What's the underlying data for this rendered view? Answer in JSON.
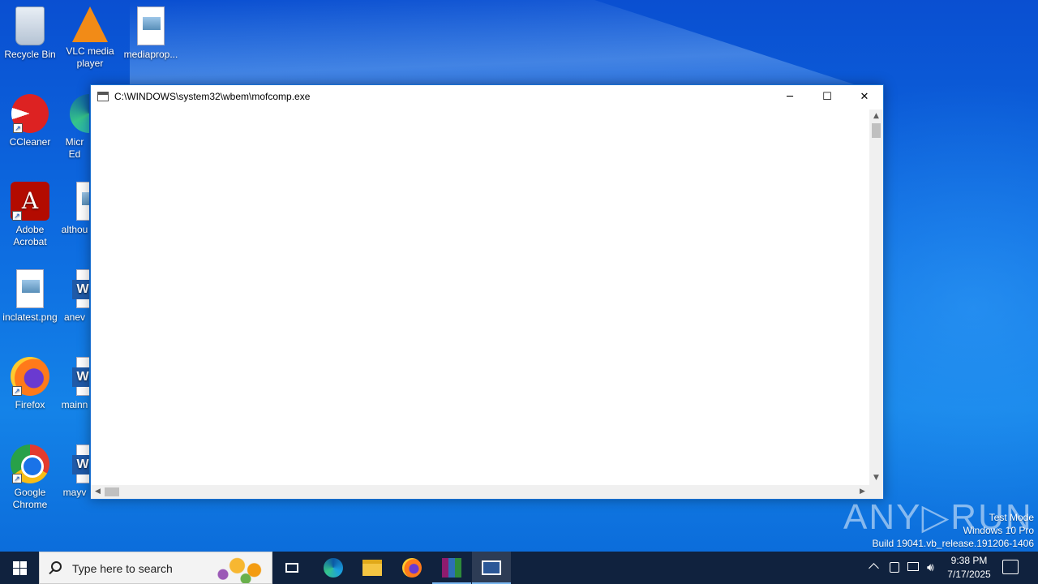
{
  "desktop": {
    "icons": [
      {
        "label": "Recycle Bin",
        "icon": "recycle-bin-icon"
      },
      {
        "label": "VLC media player",
        "icon": "vlc-icon"
      },
      {
        "label": "mediaprop...",
        "icon": "image-file-icon"
      },
      {
        "label": "CCleaner",
        "icon": "ccleaner-icon"
      },
      {
        "label": "Micr Ed",
        "icon": "edge-icon"
      },
      {
        "label": "Adobe Acrobat",
        "icon": "acrobat-icon"
      },
      {
        "label": "althou",
        "icon": "image-file-icon"
      },
      {
        "label": "inclatest.png",
        "icon": "image-file-icon"
      },
      {
        "label": "anev",
        "icon": "word-doc-icon"
      },
      {
        "label": "Firefox",
        "icon": "firefox-icon"
      },
      {
        "label": "mainn",
        "icon": "word-doc-icon"
      },
      {
        "label": "Google Chrome",
        "icon": "chrome-icon"
      },
      {
        "label": "mayv",
        "icon": "word-doc-icon"
      }
    ]
  },
  "window": {
    "title": "C:\\WINDOWS\\system32\\wbem\\mofcomp.exe",
    "minimize": "─",
    "maximize": "☐",
    "close": "✕"
  },
  "watermark": {
    "brand": "ANY▷RUN",
    "line1": "Test Mode",
    "line2": "Windows 10 Pro",
    "line3": "Build 19041.vb_release.191206-1406"
  },
  "taskbar": {
    "search_placeholder": "Type here to search",
    "time": "9:38 PM",
    "date": "7/17/2025",
    "pinned": [
      "task-view-icon",
      "edge-icon",
      "file-explorer-icon",
      "firefox-icon",
      "winrar-icon",
      "mofcomp-console-icon"
    ]
  }
}
